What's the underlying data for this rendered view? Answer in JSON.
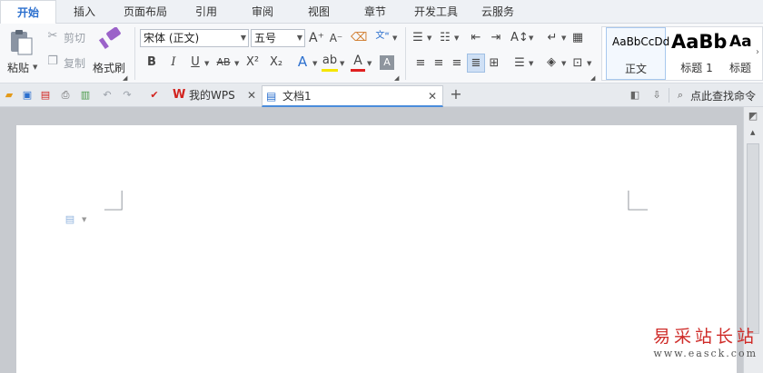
{
  "menu": {
    "tabs": [
      "开始",
      "插入",
      "页面布局",
      "引用",
      "审阅",
      "视图",
      "章节",
      "开发工具",
      "云服务"
    ]
  },
  "clipboard": {
    "paste": "粘贴",
    "cut": "剪切",
    "copy": "复制",
    "format_painter": "格式刷"
  },
  "font": {
    "name": "宋体 (正文)",
    "size": "五号"
  },
  "styles": {
    "items": [
      {
        "sample": "AaBbCcDd",
        "name": "正文"
      },
      {
        "sample": "AaBb",
        "name": "标题 1"
      },
      {
        "sample": "Aa",
        "name": "标题"
      }
    ]
  },
  "quickbar": {
    "tabs": [
      {
        "label": "我的WPS"
      },
      {
        "label": "文档1"
      }
    ],
    "search": "点此查找命令"
  },
  "watermark": {
    "text": "易采站长站",
    "url": "www.easck.com"
  },
  "colors": {
    "accent": "#2b6fce",
    "wps_red": "#d2231e",
    "highlight": "#f5e600",
    "font_red": "#e02020"
  }
}
